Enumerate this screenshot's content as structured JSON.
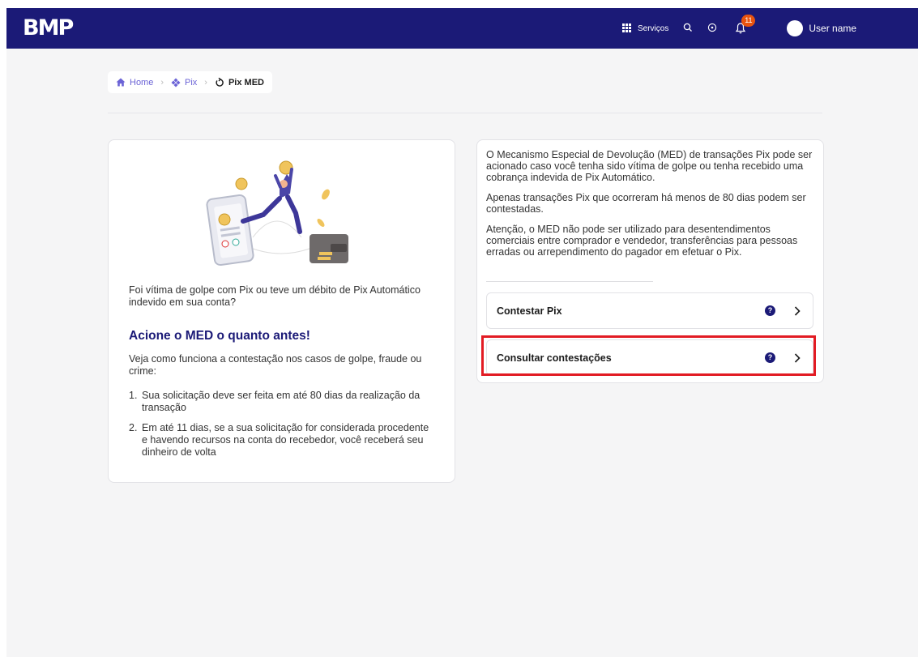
{
  "header": {
    "logo_text": "BMP",
    "services_label": "Serviços",
    "notification_count": "11",
    "user_name": "User name",
    "colors": {
      "background": "#1b1a77",
      "badge": "#e8530f"
    }
  },
  "breadcrumb": {
    "home": "Home",
    "pix": "Pix",
    "current": "Pix MED"
  },
  "left_card": {
    "intro": "Foi vítima de golpe com Pix ou teve um débito de Pix Automático indevido em sua conta?",
    "heading": "Acione o MED o quanto antes!",
    "explanation": "Veja como funciona a contestação nos casos de  golpe, fraude ou crime:",
    "steps": [
      {
        "num": "1.",
        "text": "Sua solicitação deve ser feita em até 80 dias da realização da transação"
      },
      {
        "num": "2.",
        "text": "Em até 11 dias, se a sua solicitação for  considerada procedente e havendo recursos na conta do recebedor, você receberá seu dinheiro  de volta"
      }
    ]
  },
  "right_card": {
    "paragraphs": [
      "O Mecanismo Especial de Devolução (MED) de transações Pix pode ser acionado caso você tenha sido vítima de golpe ou tenha recebido uma cobrança indevida de Pix Automático.",
      "Apenas transações Pix que ocorreram há menos de 80 dias podem ser contestadas.",
      "Atenção, o MED não pode ser utilizado para desentendimentos comerciais entre comprador e  vendedor, transferências para pessoas erradas ou arrependimento do pagador em efetuar o Pix."
    ],
    "actions": [
      {
        "label": "Contestar Pix",
        "help": "?"
      },
      {
        "label": "Consultar contestações",
        "help": "?"
      }
    ],
    "highlight_color": "#e21b23"
  }
}
